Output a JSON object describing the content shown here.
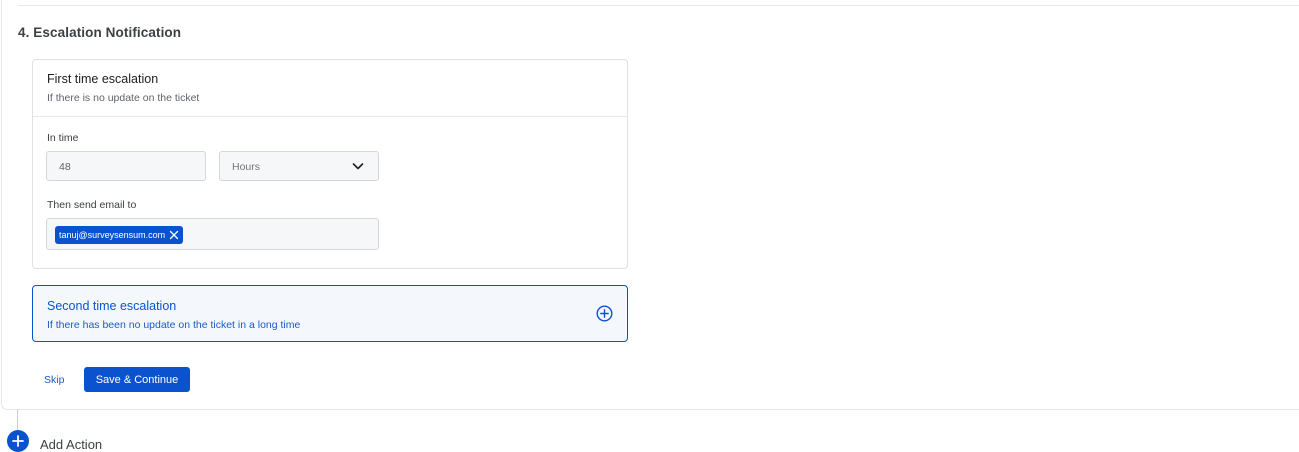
{
  "section": {
    "title": "4. Escalation Notification"
  },
  "first_escalation": {
    "title": "First time escalation",
    "subtitle": "If there is no update on the ticket",
    "in_time_label": "In time",
    "in_time_value": "48",
    "unit_selected": "Hours",
    "email_label": "Then send email to",
    "emails": [
      "tanuj@surveysensum.com"
    ]
  },
  "second_escalation": {
    "title": "Second time escalation",
    "subtitle": "If there has been no update on the ticket in a long time"
  },
  "actions": {
    "skip_label": "Skip",
    "save_label": "Save & Continue"
  },
  "add_action": {
    "label": "Add Action"
  },
  "colors": {
    "primary": "#0b53ce",
    "border": "#dfe1e5",
    "input_bg": "#f6f7f9"
  },
  "icons": {
    "unit_dropdown": "chevron-down-icon",
    "chip_remove": "close-icon",
    "expand_second": "plus-circle-icon",
    "add_action": "plus-icon"
  }
}
